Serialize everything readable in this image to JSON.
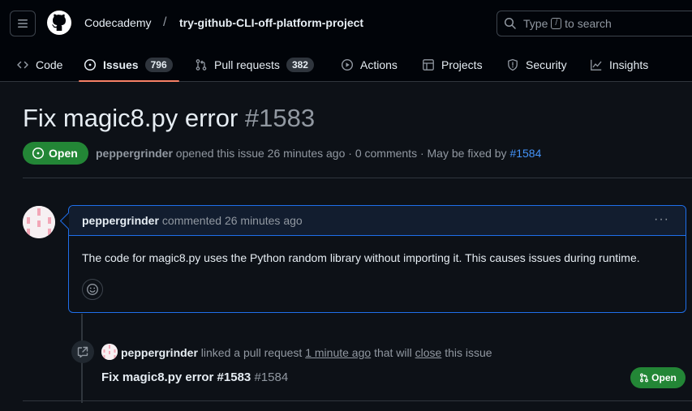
{
  "header": {
    "org": "Codecademy",
    "separator": "/",
    "repo": "try-github-CLI-off-platform-project",
    "search": {
      "prefix": "Type",
      "key": "/",
      "suffix": "to search"
    }
  },
  "tabs": [
    {
      "label": "Code",
      "icon": "code-icon"
    },
    {
      "label": "Issues",
      "icon": "issue-opened-icon",
      "count": "796",
      "active": true
    },
    {
      "label": "Pull requests",
      "icon": "git-pull-request-icon",
      "count": "382"
    },
    {
      "label": "Actions",
      "icon": "play-icon"
    },
    {
      "label": "Projects",
      "icon": "table-icon"
    },
    {
      "label": "Security",
      "icon": "shield-icon"
    },
    {
      "label": "Insights",
      "icon": "graph-icon"
    }
  ],
  "issue": {
    "title": "Fix magic8.py error",
    "number": "#1583",
    "state": "Open",
    "author": "peppergrinder",
    "meta_opened": "opened this issue 26 minutes ago · 0 comments · May be fixed by",
    "fixed_by": "#1584"
  },
  "comment": {
    "author": "peppergrinder",
    "action": "commented 26 minutes ago",
    "menu": "···",
    "body": "The code for magic8.py uses the Python random library without importing it. This causes issues during runtime."
  },
  "event": {
    "author": "peppergrinder",
    "text_1": "linked a pull request",
    "time": "1 minute ago",
    "text_2": "that will",
    "close": "close",
    "text_3": "this issue",
    "pr_title": "Fix magic8.py error #1583",
    "pr_number": "#1584",
    "pr_state": "Open"
  },
  "colors": {
    "accent_open": "#238636",
    "link": "#4493f8",
    "tab_underline": "#f78166"
  }
}
